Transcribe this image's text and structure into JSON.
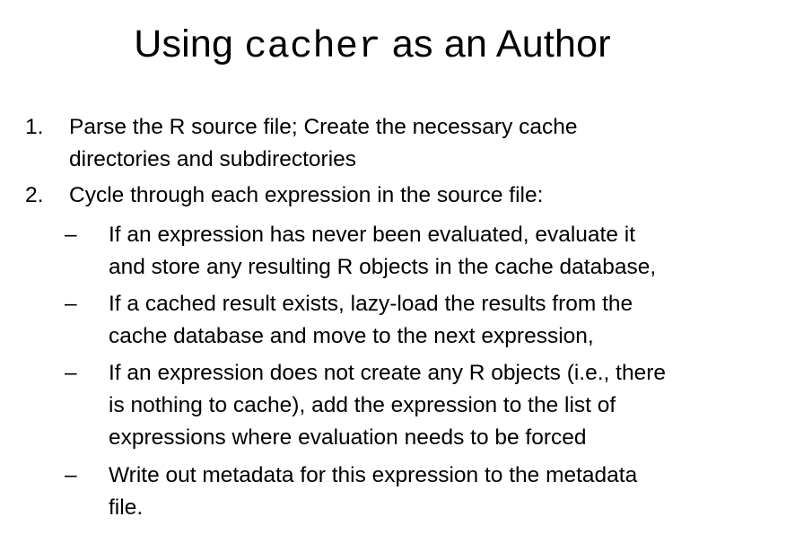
{
  "slide": {
    "title": {
      "prefix": "Using ",
      "code": "cacher",
      "suffix": " as an Author"
    },
    "steps": [
      {
        "number": "1.",
        "lines": [
          "Parse the R source file; Create the necessary cache",
          "directories and subdirectories"
        ]
      },
      {
        "number": "2.",
        "lines": [
          "Cycle through each expression in the source file:"
        ],
        "substeps": [
          {
            "marker": "–",
            "lines": [
              "If an expression has never been evaluated, evaluate it",
              "and store any resulting R objects in the cache database,"
            ]
          },
          {
            "marker": "–",
            "lines": [
              "If a cached result exists, lazy-load the results from the",
              "cache database and move to the next expression,"
            ]
          },
          {
            "marker": "–",
            "lines": [
              "If an expression does not create any R objects (i.e., there",
              "is nothing to cache), add the expression to the list of",
              "expressions where evaluation needs to be forced"
            ]
          },
          {
            "marker": "–",
            "lines": [
              "Write out metadata for this expression to the metadata",
              "file."
            ]
          }
        ]
      }
    ]
  }
}
